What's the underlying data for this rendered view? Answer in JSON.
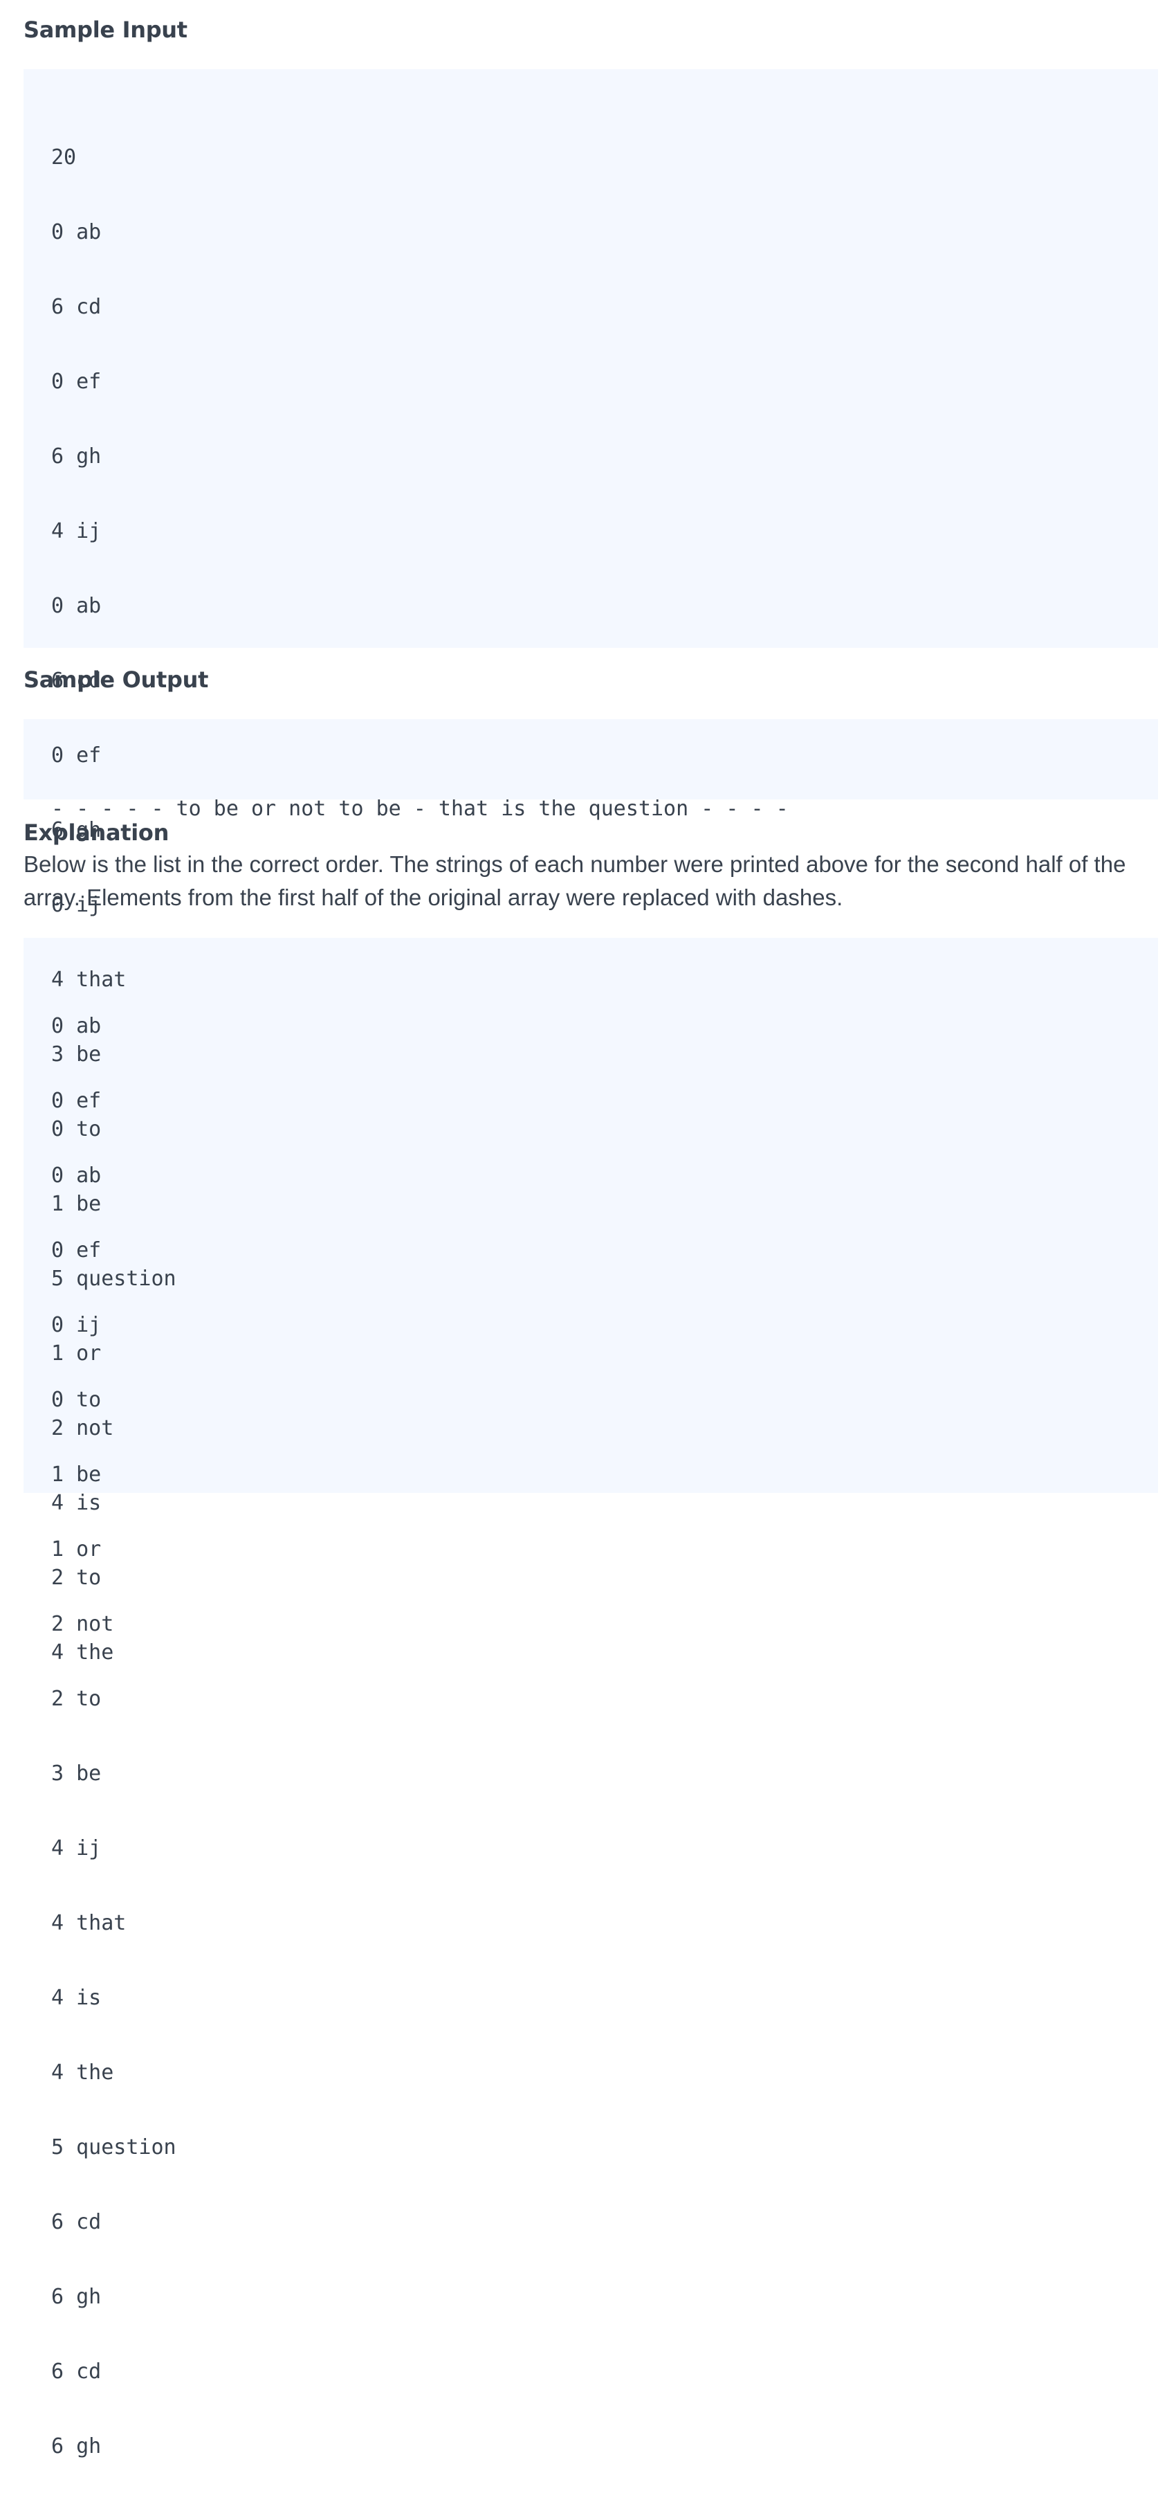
{
  "sample_input": {
    "heading": "Sample Input",
    "lines": [
      "20",
      "0 ab",
      "6 cd",
      "0 ef",
      "6 gh",
      "4 ij",
      "0 ab",
      "6 cd",
      "0 ef",
      "6 gh",
      "0 ij",
      "4 that",
      "3 be",
      "0 to",
      "1 be",
      "5 question",
      "1 or",
      "2 not",
      "4 is",
      "2 to",
      "4 the"
    ]
  },
  "sample_output": {
    "heading": "Sample Output",
    "line": "- - - - - to be or not to be - that is the question - - - -"
  },
  "explanation": {
    "heading": "Explanation",
    "text": "Below is the list in the correct order. The strings of each number were printed above for the second half of the array. Elements from the first half of the original array were replaced with dashes.",
    "lines": [
      "0 ab",
      "0 ef",
      "0 ab",
      "0 ef",
      "0 ij",
      "0 to",
      "1 be",
      "1 or",
      "2 not",
      "2 to",
      "3 be",
      "4 ij",
      "4 that",
      "4 is",
      "4 the",
      "5 question",
      "6 cd",
      "6 gh",
      "6 cd",
      "6 gh"
    ]
  }
}
